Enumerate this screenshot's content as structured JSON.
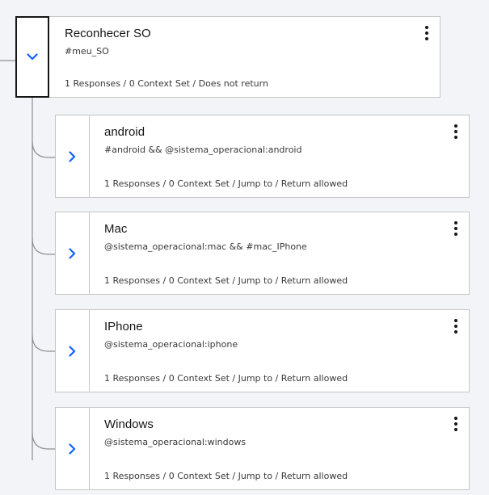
{
  "colors": {
    "background": "#f2f4f8",
    "card": "#ffffff",
    "border": "#c6c6c6",
    "accent": "#0f62fe",
    "connector": "#8d8d8d"
  },
  "parent_node": {
    "title": "Reconhecer SO",
    "condition": "#meu_SO",
    "summary": "1 Responses / 0 Context Set / Does not return",
    "toggle_icon": "chevron-down-icon",
    "menu_icon": "overflow-menu-icon"
  },
  "child_nodes": [
    {
      "title": "android",
      "condition": "#android && @sistema_operacional:android",
      "summary": "1 Responses / 0 Context Set / Jump to / Return allowed",
      "toggle_icon": "chevron-right-icon",
      "menu_icon": "overflow-menu-icon"
    },
    {
      "title": "Mac",
      "condition": "@sistema_operacional:mac && #mac_IPhone",
      "summary": "1 Responses / 0 Context Set / Jump to / Return allowed",
      "toggle_icon": "chevron-right-icon",
      "menu_icon": "overflow-menu-icon"
    },
    {
      "title": "IPhone",
      "condition": "@sistema_operacional:iphone",
      "summary": "1 Responses / 0 Context Set / Jump to / Return allowed",
      "toggle_icon": "chevron-right-icon",
      "menu_icon": "overflow-menu-icon"
    },
    {
      "title": "Windows",
      "condition": "@sistema_operacional:windows",
      "summary": "1 Responses / 0 Context Set / Jump to / Return allowed",
      "toggle_icon": "chevron-right-icon",
      "menu_icon": "overflow-menu-icon"
    }
  ]
}
